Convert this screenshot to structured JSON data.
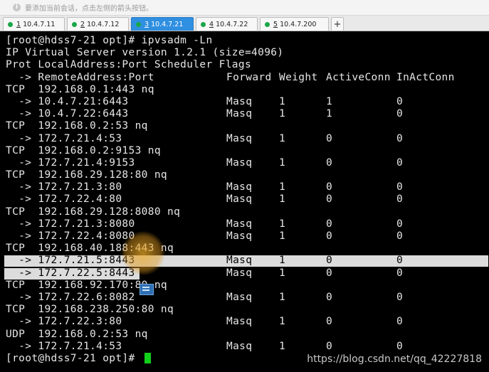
{
  "hint": {
    "text": "要添加当前会话，点击左侧的箭头按钮。"
  },
  "tabs": [
    {
      "num": "1",
      "label": " 10.4.7.11",
      "active": false
    },
    {
      "num": "2",
      "label": " 10.4.7.12",
      "active": false
    },
    {
      "num": "3",
      "label": " 10.4.7.21",
      "active": true
    },
    {
      "num": "4",
      "label": " 10.4.7.22",
      "active": false
    },
    {
      "num": "5",
      "label": " 10.4.7.200",
      "active": false
    }
  ],
  "add_tab": "+",
  "terminal": {
    "lines": [
      {
        "c1": "[root@hdss7-21 opt]# ipvsadm -Ln"
      },
      {
        "c1": "IP Virtual Server version 1.2.1 (size=4096)"
      },
      {
        "c1": "Prot LocalAddress:Port Scheduler Flags"
      },
      {
        "c1": "  -> RemoteAddress:Port",
        "c2": "Forward",
        "c3": "Weight",
        "c4": "ActiveConn",
        "c5": "InActConn"
      },
      {
        "c1": "TCP  192.168.0.1:443 nq"
      },
      {
        "c1": "  -> 10.4.7.21:6443",
        "c2": "Masq",
        "c3": "1",
        "c4": "1",
        "c5": "0"
      },
      {
        "c1": "  -> 10.4.7.22:6443",
        "c2": "Masq",
        "c3": "1",
        "c4": "1",
        "c5": "0"
      },
      {
        "c1": "TCP  192.168.0.2:53 nq"
      },
      {
        "c1": "  -> 172.7.21.4:53",
        "c2": "Masq",
        "c3": "1",
        "c4": "0",
        "c5": "0"
      },
      {
        "c1": "TCP  192.168.0.2:9153 nq"
      },
      {
        "c1": "  -> 172.7.21.4:9153",
        "c2": "Masq",
        "c3": "1",
        "c4": "0",
        "c5": "0"
      },
      {
        "c1": "TCP  192.168.29.128:80 nq"
      },
      {
        "c1": "  -> 172.7.21.3:80",
        "c2": "Masq",
        "c3": "1",
        "c4": "0",
        "c5": "0"
      },
      {
        "c1": "  -> 172.7.22.4:80",
        "c2": "Masq",
        "c3": "1",
        "c4": "0",
        "c5": "0"
      },
      {
        "c1": "TCP  192.168.29.128:8080 nq"
      },
      {
        "c1": "  -> 172.7.21.3:8080",
        "c2": "Masq",
        "c3": "1",
        "c4": "0",
        "c5": "0"
      },
      {
        "c1": "  -> 172.7.22.4:8080",
        "c2": "Masq",
        "c3": "1",
        "c4": "0",
        "c5": "0"
      },
      {
        "c1": "TCP  192.168.40.188:443 nq"
      },
      {
        "c1": "  -> 172.7.21.5:8443",
        "c2": "Masq",
        "c3": "1",
        "c4": "0",
        "c5": "0",
        "hl": "full"
      },
      {
        "c1": "  -> 172.7.22.5:8443",
        "c2": "Masq",
        "c3": "1",
        "c4": "0",
        "c5": "0",
        "hl": "partial"
      },
      {
        "c1": "TCP  192.168.92.170:80 nq"
      },
      {
        "c1": "  -> 172.7.22.6:8082",
        "c2": "Masq",
        "c3": "1",
        "c4": "0",
        "c5": "0"
      },
      {
        "c1": "TCP  192.168.238.250:80 nq"
      },
      {
        "c1": "  -> 172.7.22.3:80",
        "c2": "Masq",
        "c3": "1",
        "c4": "0",
        "c5": "0"
      },
      {
        "c1": "UDP  192.168.0.2:53 nq"
      },
      {
        "c1": "  -> 172.7.21.4:53",
        "c2": "Masq",
        "c3": "1",
        "c4": "0",
        "c5": "0"
      },
      {
        "c1": "[root@hdss7-21 opt]# ",
        "cursor": true
      }
    ]
  },
  "watermark": "https://blog.csdn.net/qq_42227818",
  "colors": {
    "background": "#000000",
    "text": "#e6e6e6",
    "active_tab": "#2f8fe0",
    "session_dot": "#18a74a",
    "cursor": "#10d01a"
  }
}
